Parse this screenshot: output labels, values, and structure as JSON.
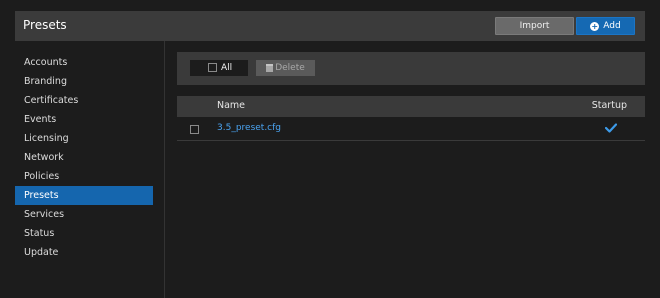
{
  "header": {
    "title": "Presets",
    "import_label": "Import",
    "add_label": "Add"
  },
  "sidebar": {
    "items": [
      {
        "label": "Accounts",
        "active": false
      },
      {
        "label": "Branding",
        "active": false
      },
      {
        "label": "Certificates",
        "active": false
      },
      {
        "label": "Events",
        "active": false
      },
      {
        "label": "Licensing",
        "active": false
      },
      {
        "label": "Network",
        "active": false
      },
      {
        "label": "Policies",
        "active": false
      },
      {
        "label": "Presets",
        "active": true
      },
      {
        "label": "Services",
        "active": false
      },
      {
        "label": "Status",
        "active": false
      },
      {
        "label": "Update",
        "active": false
      }
    ]
  },
  "toolbar": {
    "all_label": "All",
    "delete_label": "Delete"
  },
  "table": {
    "columns": [
      "Name",
      "Startup"
    ],
    "rows": [
      {
        "name": "3.5_preset.cfg",
        "startup": true
      }
    ]
  },
  "colors": {
    "accent": "#1566ae",
    "link": "#4aa3f0",
    "check": "#3d9be9"
  },
  "icons": {
    "add": "plus-circle-icon",
    "delete": "trash-icon",
    "startup": "checkmark-icon"
  }
}
